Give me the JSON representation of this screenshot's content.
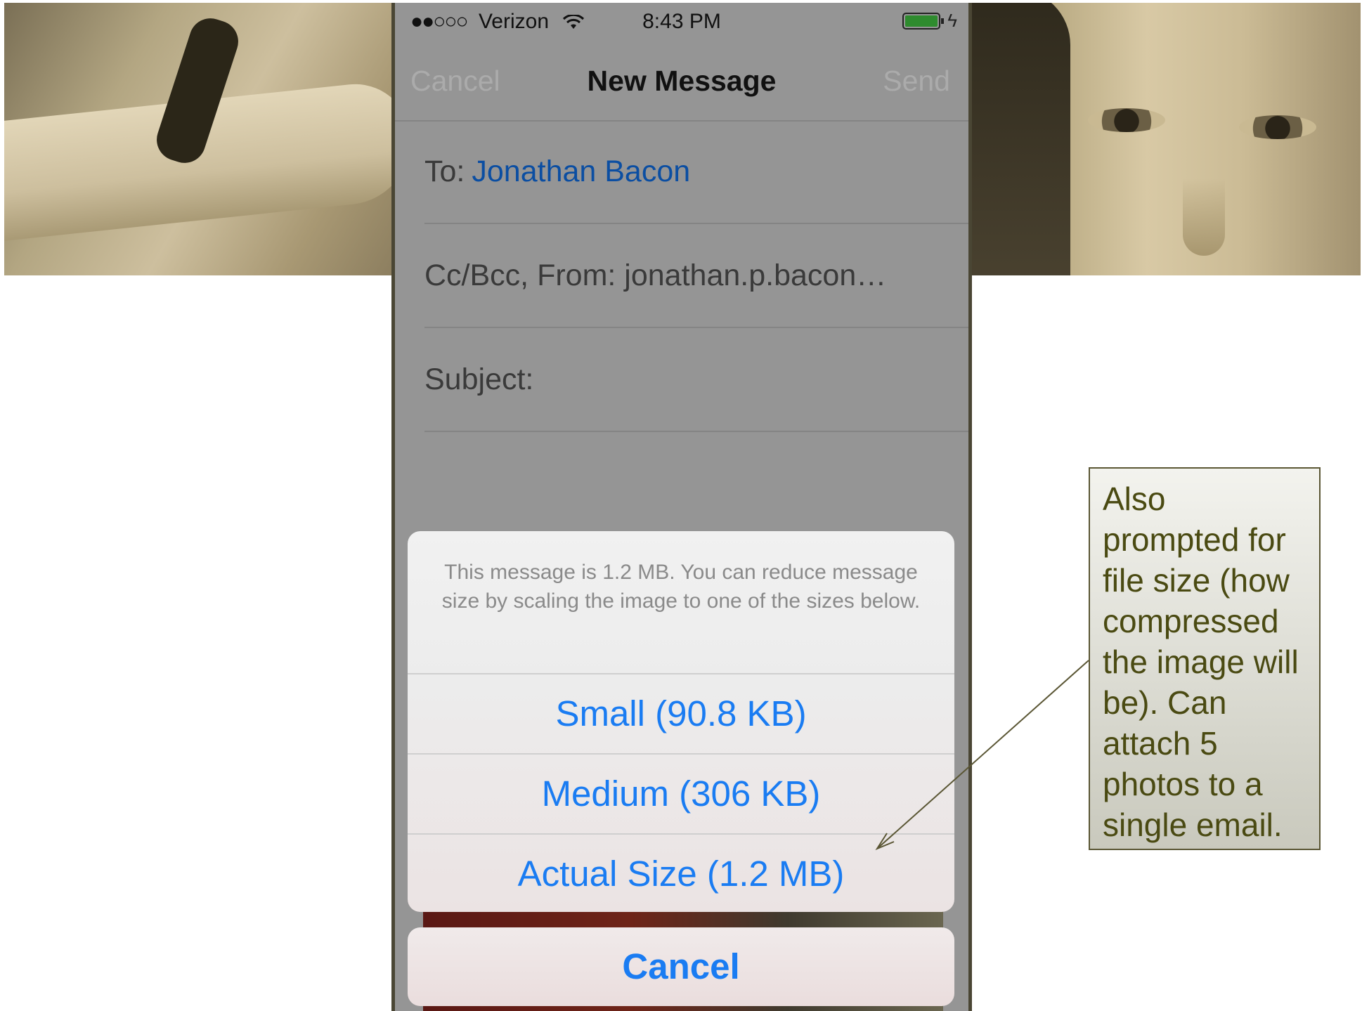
{
  "status_bar": {
    "signal": "●●○○○",
    "carrier": "Verizon",
    "time": "8:43 PM"
  },
  "nav": {
    "cancel_label": "Cancel",
    "title": "New Message",
    "send_label": "Send"
  },
  "compose": {
    "to_label": "To:",
    "to_value": "Jonathan Bacon",
    "cc_from": "Cc/Bcc, From:  jonathan.p.bacon…",
    "subject_label": "Subject:"
  },
  "action_sheet": {
    "message": "This message is 1.2 MB. You can reduce message size by scaling the image to one of the sizes below.",
    "options": [
      {
        "label": "Small (90.8 KB)"
      },
      {
        "label": "Medium (306 KB)"
      },
      {
        "label": "Actual Size (1.2 MB)"
      }
    ],
    "cancel_label": "Cancel"
  },
  "callout": {
    "text": "Also prompted for file size (how compressed the image will be). Can attach 5 photos to a single email."
  },
  "colors": {
    "accent_blue": "#1a7cf2",
    "contact_blue": "#0b4ea2",
    "battery_green": "#2e8b2e",
    "callout_text": "#4a4a12"
  }
}
